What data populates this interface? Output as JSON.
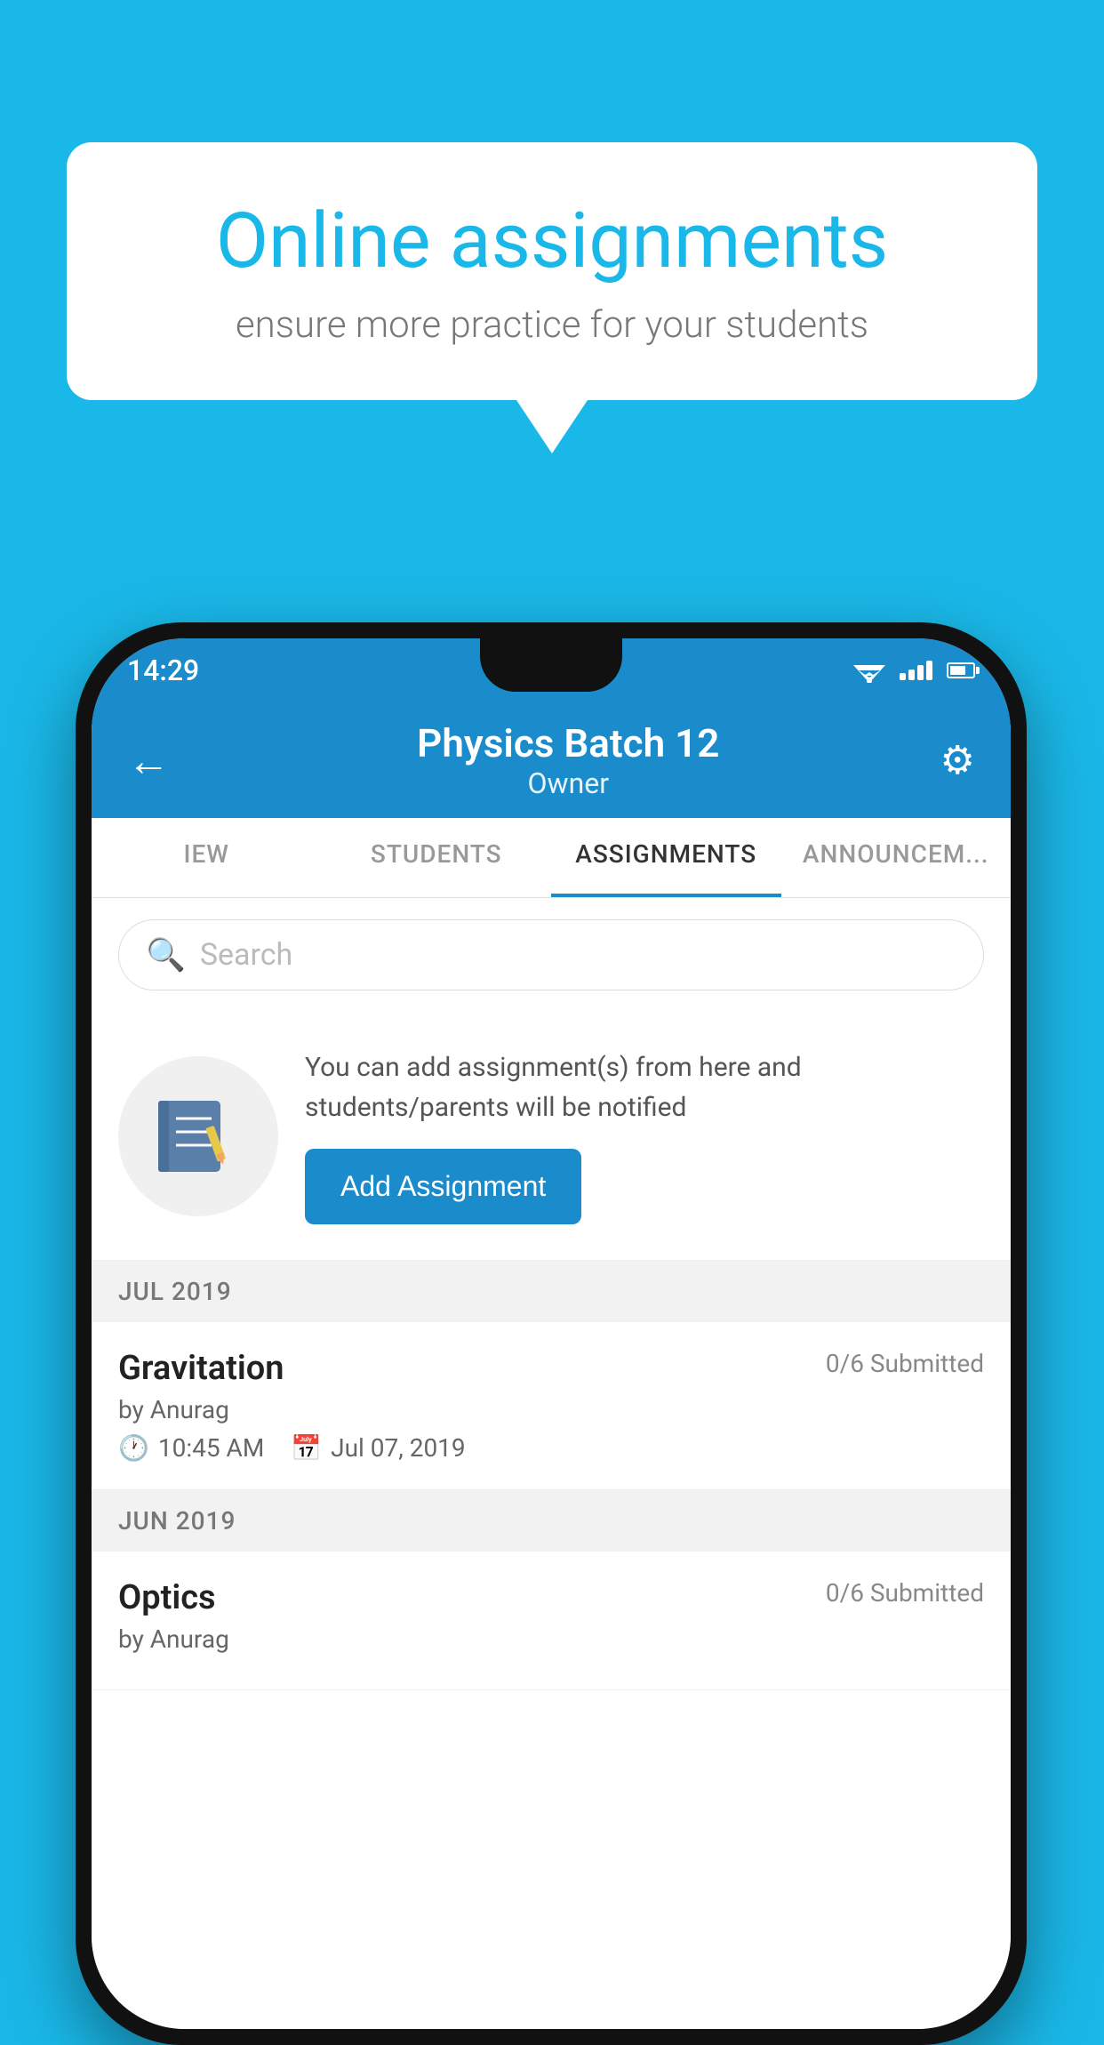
{
  "background_color": "#1ab8e8",
  "speech_bubble": {
    "title": "Online assignments",
    "subtitle": "ensure more practice for your students"
  },
  "status_bar": {
    "time": "14:29",
    "wifi": "wifi",
    "signal": "signal",
    "battery": "battery"
  },
  "app_bar": {
    "title": "Physics Batch 12",
    "subtitle": "Owner",
    "back_label": "back",
    "settings_label": "settings"
  },
  "tabs": [
    {
      "label": "IEW",
      "active": false
    },
    {
      "label": "STUDENTS",
      "active": false
    },
    {
      "label": "ASSIGNMENTS",
      "active": true
    },
    {
      "label": "ANNOUNCEM...",
      "active": false
    }
  ],
  "search": {
    "placeholder": "Search"
  },
  "info_card": {
    "text": "You can add assignment(s) from here and students/parents will be notified",
    "button_label": "Add Assignment"
  },
  "sections": [
    {
      "header": "JUL 2019",
      "assignments": [
        {
          "title": "Gravitation",
          "submitted": "0/6 Submitted",
          "author": "by Anurag",
          "time": "10:45 AM",
          "date": "Jul 07, 2019"
        }
      ]
    },
    {
      "header": "JUN 2019",
      "assignments": [
        {
          "title": "Optics",
          "submitted": "0/6 Submitted",
          "author": "by Anurag",
          "time": "",
          "date": ""
        }
      ]
    }
  ]
}
